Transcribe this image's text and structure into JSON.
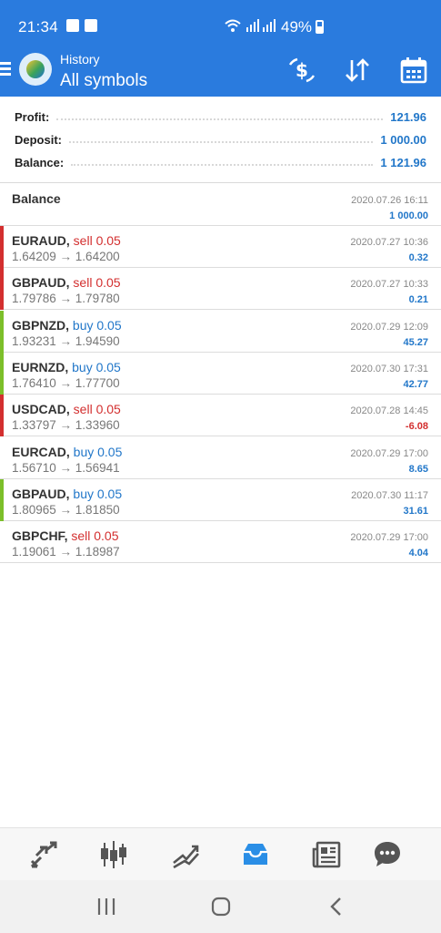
{
  "status_bar": {
    "time": "21:34",
    "battery": "49%"
  },
  "toolbar": {
    "title": "History",
    "subtitle": "All symbols",
    "icons": [
      "menu-icon",
      "app-logo",
      "symbol-filter-icon",
      "sort-icon",
      "calendar-icon"
    ]
  },
  "summary": {
    "profit_label": "Profit:",
    "profit_value": "121.96",
    "deposit_label": "Deposit:",
    "deposit_value": "1 000.00",
    "balance_label": "Balance:",
    "balance_value": "1 121.96"
  },
  "balance_entry": {
    "label": "Balance",
    "date": "2020.07.26 16:11",
    "amount": "1 000.00"
  },
  "trades": [
    {
      "symbol": "EURAUD",
      "side": "sell 0.05",
      "prices": "1.64209 → 1.64200",
      "date": "2020.07.27 10:36",
      "profit": "0.32",
      "bar": "#d32f2f",
      "side_color": "red",
      "profit_color": "blue"
    },
    {
      "symbol": "GBPAUD",
      "side": "sell 0.05",
      "prices": "1.79786 → 1.79780",
      "date": "2020.07.27 10:33",
      "profit": "0.21",
      "bar": "#d32f2f",
      "side_color": "red",
      "profit_color": "blue"
    },
    {
      "symbol": "GBPNZD",
      "side": "buy 0.05",
      "prices": "1.93231 → 1.94590",
      "date": "2020.07.29 12:09",
      "profit": "45.27",
      "bar": "#7cbf2a",
      "side_color": "blue",
      "profit_color": "blue"
    },
    {
      "symbol": "EURNZD",
      "side": "buy 0.05",
      "prices": "1.76410 → 1.77700",
      "date": "2020.07.30 17:31",
      "profit": "42.77",
      "bar": "#7cbf2a",
      "side_color": "blue",
      "profit_color": "blue"
    },
    {
      "symbol": "USDCAD",
      "side": "sell 0.05",
      "prices": "1.33797 → 1.33960",
      "date": "2020.07.28 14:45",
      "profit": "-6.08",
      "bar": "#d32f2f",
      "side_color": "red",
      "profit_color": "red"
    },
    {
      "symbol": "EURCAD",
      "side": "buy 0.05",
      "prices": "1.56710 → 1.56941",
      "date": "2020.07.29 17:00",
      "profit": "8.65",
      "bar": "",
      "side_color": "blue",
      "profit_color": "blue"
    },
    {
      "symbol": "GBPAUD",
      "side": "buy 0.05",
      "prices": "1.80965 → 1.81850",
      "date": "2020.07.30 11:17",
      "profit": "31.61",
      "bar": "#7cbf2a",
      "side_color": "blue",
      "profit_color": "blue"
    },
    {
      "symbol": "GBPCHF",
      "side": "sell 0.05",
      "prices": "1.19061 → 1.18987",
      "date": "2020.07.29 17:00",
      "profit": "4.04",
      "bar": "",
      "side_color": "red",
      "profit_color": "blue"
    }
  ],
  "bottom_nav": [
    "quotes-icon",
    "chart-icon",
    "trade-icon",
    "history-icon",
    "news-icon",
    "messages-icon"
  ],
  "colors": {
    "accent": "#2a7bde",
    "active_tab": "#2a8ee6",
    "sell": "#d32f2f",
    "buy": "#2277c9",
    "profit_bar": "#7cbf2a"
  }
}
